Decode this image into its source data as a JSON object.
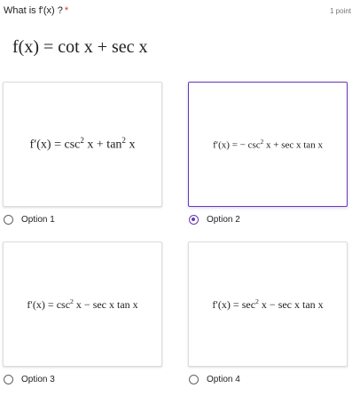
{
  "question": {
    "title": "What is f'(x) ?",
    "required_marker": "*",
    "points": "1 point",
    "formula": "f(x) = cot x + sec x"
  },
  "options": [
    {
      "label": "Option 1",
      "lhs": "f′(x) = csc",
      "sup1": "2",
      "mid": " x + tan",
      "sup2": "2",
      "tail": " x",
      "selected": false
    },
    {
      "label": "Option 2",
      "lhs": "f′(x) = − csc",
      "sup1": "2",
      "mid": " x + sec x tan x",
      "selected": true
    },
    {
      "label": "Option 3",
      "lhs": "f′(x) = csc",
      "sup1": "2",
      "mid": " x − sec x tan x",
      "selected": false
    },
    {
      "label": "Option 4",
      "lhs": "f′(x) = sec",
      "sup1": "2",
      "mid": " x − sec x tan x",
      "selected": false
    }
  ],
  "colors": {
    "accent": "#673ab7",
    "required": "#d93025"
  }
}
